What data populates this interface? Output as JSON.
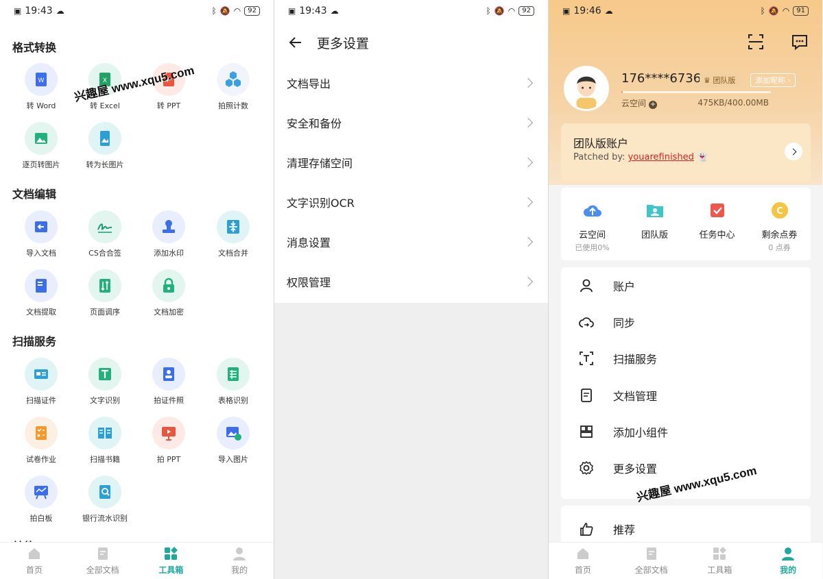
{
  "status": {
    "p1": {
      "time": "19:43",
      "battery": "92"
    },
    "p2": {
      "time": "19:43",
      "battery": "92"
    },
    "p3": {
      "time": "19:46",
      "battery": "91"
    }
  },
  "toolbox": {
    "sections": {
      "format": "格式转换",
      "edit": "文档编辑",
      "scan": "扫描服务",
      "other": "其他"
    },
    "tools": {
      "to_word": "转 Word",
      "to_excel": "转 Excel",
      "to_ppt": "转 PPT",
      "photo_count": "拍照计数",
      "page_to_image": "逐页转图片",
      "to_long_image": "转为长图片",
      "import_doc": "导入文档",
      "cs_sign": "CS合合签",
      "watermark": "添加水印",
      "merge": "文档合并",
      "extract": "文档提取",
      "reorder": "页面调序",
      "encrypt": "文档加密",
      "scan_id": "扫描证件",
      "ocr": "文字识别",
      "id_photo": "拍证件照",
      "table_ocr": "表格识别",
      "exam": "试卷作业",
      "scan_book": "扫描书籍",
      "photo_ppt": "拍 PPT",
      "import_image": "导入图片",
      "whiteboard": "拍白板",
      "bank_ocr": "银行流水识别"
    }
  },
  "tabs": {
    "home": "首页",
    "all_docs": "全部文档",
    "toolbox": "工具箱",
    "mine": "我的"
  },
  "settings": {
    "title": "更多设置",
    "items": [
      "文档导出",
      "安全和备份",
      "清理存储空间",
      "文字识别OCR",
      "消息设置",
      "权限管理"
    ]
  },
  "profile": {
    "phone": "176****6736",
    "badge": "团队版",
    "nickname_btn": "添加昵称",
    "cloud_label": "云空间",
    "storage": "475KB/400.00MB",
    "storage_used_fraction": 0.001,
    "team_title": "团队版账户",
    "patched_prefix": "Patched by: ",
    "patched_name": "youarefinished",
    "quick": {
      "cloud": "云空间",
      "cloud_sub": "已使用0%",
      "team": "团队版",
      "tasks": "任务中心",
      "points": "剩余点券",
      "points_sub": "0 点券"
    },
    "menu": [
      "账户",
      "同步",
      "扫描服务",
      "文档管理",
      "添加小组件",
      "更多设置"
    ],
    "menu2": "推荐"
  },
  "watermark": "兴趣屋 www.xqu5.com",
  "colors": {
    "accent": "#1fa89c",
    "gold": "#f7c98a"
  }
}
